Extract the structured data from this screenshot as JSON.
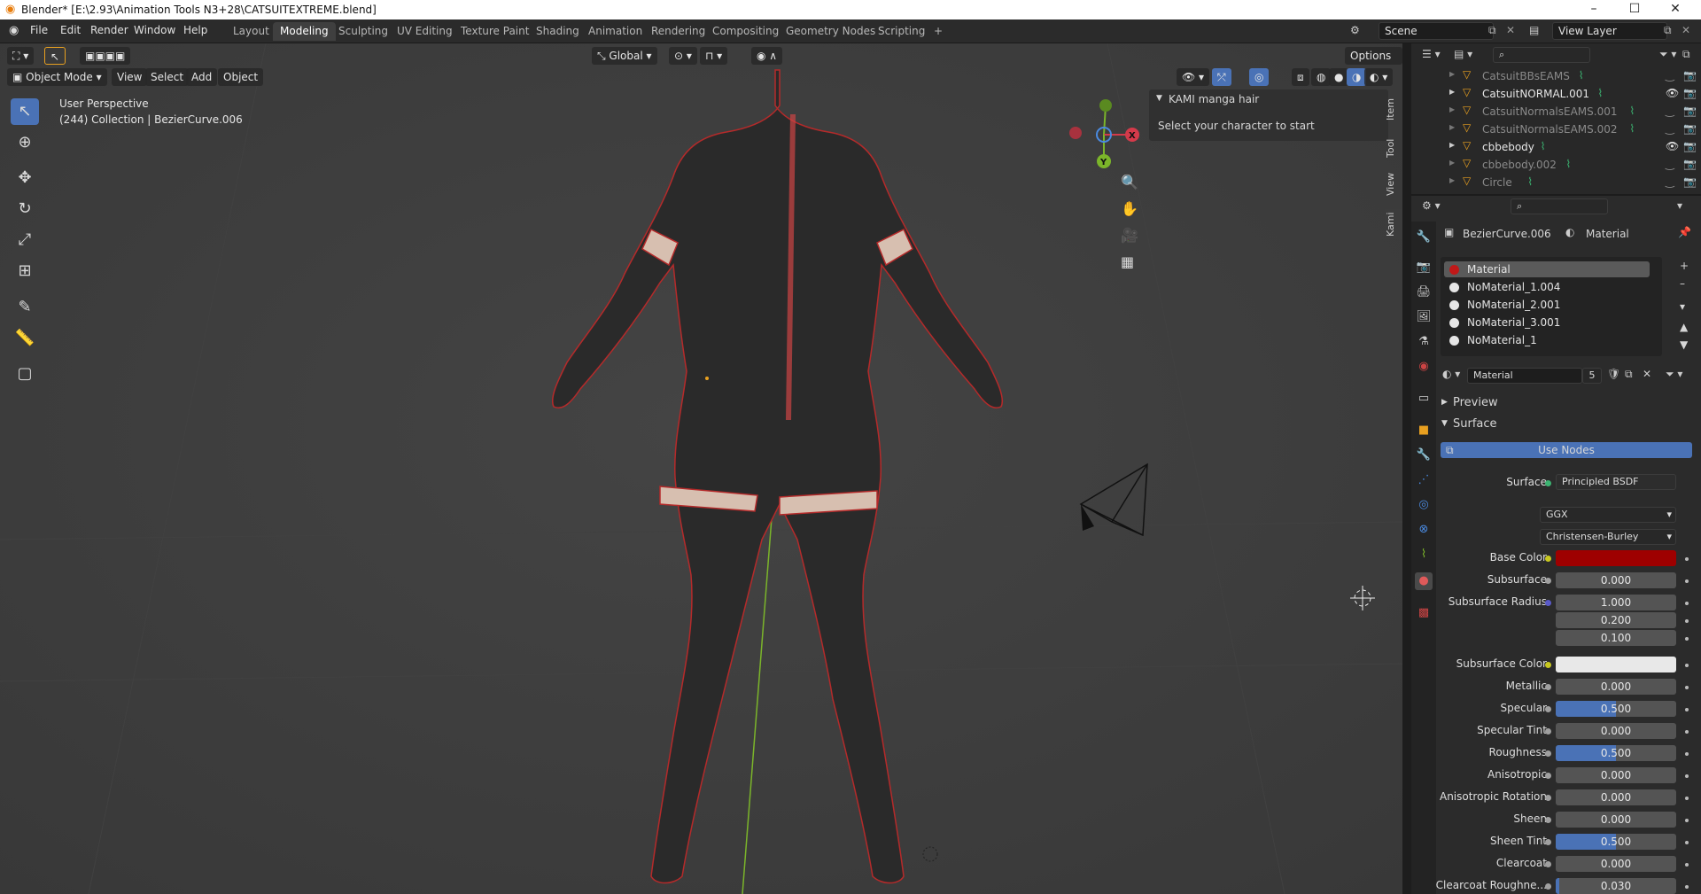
{
  "window": {
    "title": "Blender* [E:\\2.93\\Animation Tools N3+28\\CATSUITEXTREME.blend]",
    "controls": [
      "–",
      "☐",
      "✕"
    ]
  },
  "menu": [
    "File",
    "Edit",
    "Render",
    "Window",
    "Help"
  ],
  "workspaces": [
    {
      "label": "Layout",
      "active": false
    },
    {
      "label": "Modeling",
      "active": true
    },
    {
      "label": "Sculpting",
      "active": false
    },
    {
      "label": "UV Editing",
      "active": false
    },
    {
      "label": "Texture Paint",
      "active": false
    },
    {
      "label": "Shading",
      "active": false
    },
    {
      "label": "Animation",
      "active": false
    },
    {
      "label": "Rendering",
      "active": false
    },
    {
      "label": "Compositing",
      "active": false
    },
    {
      "label": "Geometry Nodes",
      "active": false
    },
    {
      "label": "Scripting",
      "active": false
    }
  ],
  "add_workspace": "+",
  "scene": {
    "name": "Scene",
    "view_layer": "View Layer"
  },
  "viewport": {
    "mode": "Object Mode",
    "menus": [
      "View",
      "Select",
      "Add",
      "Object"
    ],
    "transform_orientation": "Global",
    "options_label": "Options",
    "info_line1": "User Perspective",
    "info_line2": "(244) Collection | BezierCurve.006",
    "side_tabs": [
      "Item",
      "Tool",
      "View",
      "Kami"
    ],
    "gizmo_axes": {
      "x": "X",
      "y": "Y",
      "z": "Z"
    }
  },
  "kami_panel": {
    "title": "KAMI manga hair",
    "message": "Select your character to start"
  },
  "outliner": {
    "search_placeholder": "",
    "items": [
      {
        "name": "CatsuitBBsEAMS",
        "visible": false
      },
      {
        "name": "CatsuitNORMAL.001",
        "visible": true
      },
      {
        "name": "CatsuitNormalsEAMS.001",
        "visible": false
      },
      {
        "name": "CatsuitNormalsEAMS.002",
        "visible": false
      },
      {
        "name": "cbbebody",
        "visible": true
      },
      {
        "name": "cbbebody.002",
        "visible": false
      },
      {
        "name": "Circle",
        "visible": false
      }
    ]
  },
  "properties": {
    "object_name": "BezierCurve.006",
    "context": "Material",
    "material_slots": [
      "Material",
      "NoMaterial_1.004",
      "NoMaterial_2.001",
      "NoMaterial_3.001",
      "NoMaterial_1"
    ],
    "active_material": "Material",
    "user_count": "5",
    "sections": {
      "preview": "Preview",
      "surface": "Surface"
    },
    "use_nodes": "Use Nodes",
    "surface_label": "Surface",
    "surface_shader": "Principled BSDF",
    "distribution": "GGX",
    "subsurface_method": "Christensen-Burley",
    "fields": [
      {
        "label": "Base Color",
        "value": "",
        "kind": "color",
        "color": "#9e0000",
        "dot": "#c8c820"
      },
      {
        "label": "Subsurface",
        "value": "0.000",
        "kind": "num"
      },
      {
        "label": "Subsurface Radius",
        "value": "1.000",
        "kind": "num",
        "dot": "#5a5ac8"
      },
      {
        "label": "",
        "value": "0.200",
        "kind": "num"
      },
      {
        "label": "",
        "value": "0.100",
        "kind": "num"
      },
      {
        "label": "Subsurface Color",
        "value": "",
        "kind": "color",
        "color": "#e8e8e8",
        "dot": "#c8c820"
      },
      {
        "label": "Metallic",
        "value": "0.000",
        "kind": "num"
      },
      {
        "label": "Specular",
        "value": "0.500",
        "kind": "slider",
        "fraction": 0.5
      },
      {
        "label": "Specular Tint",
        "value": "0.000",
        "kind": "num"
      },
      {
        "label": "Roughness",
        "value": "0.500",
        "kind": "slider",
        "fraction": 0.5
      },
      {
        "label": "Anisotropic",
        "value": "0.000",
        "kind": "num"
      },
      {
        "label": "Anisotropic Rotation",
        "value": "0.000",
        "kind": "num"
      },
      {
        "label": "Sheen",
        "value": "0.000",
        "kind": "num"
      },
      {
        "label": "Sheen Tint",
        "value": "0.500",
        "kind": "slider",
        "fraction": 0.5
      },
      {
        "label": "Clearcoat",
        "value": "0.000",
        "kind": "num"
      },
      {
        "label": "Clearcoat Roughne...",
        "value": "0.030",
        "kind": "slider",
        "fraction": 0.03
      }
    ]
  },
  "colors": {
    "accent": "#4a72b6",
    "header": "#2b2b2b",
    "viewport": "#3b3b3b"
  }
}
